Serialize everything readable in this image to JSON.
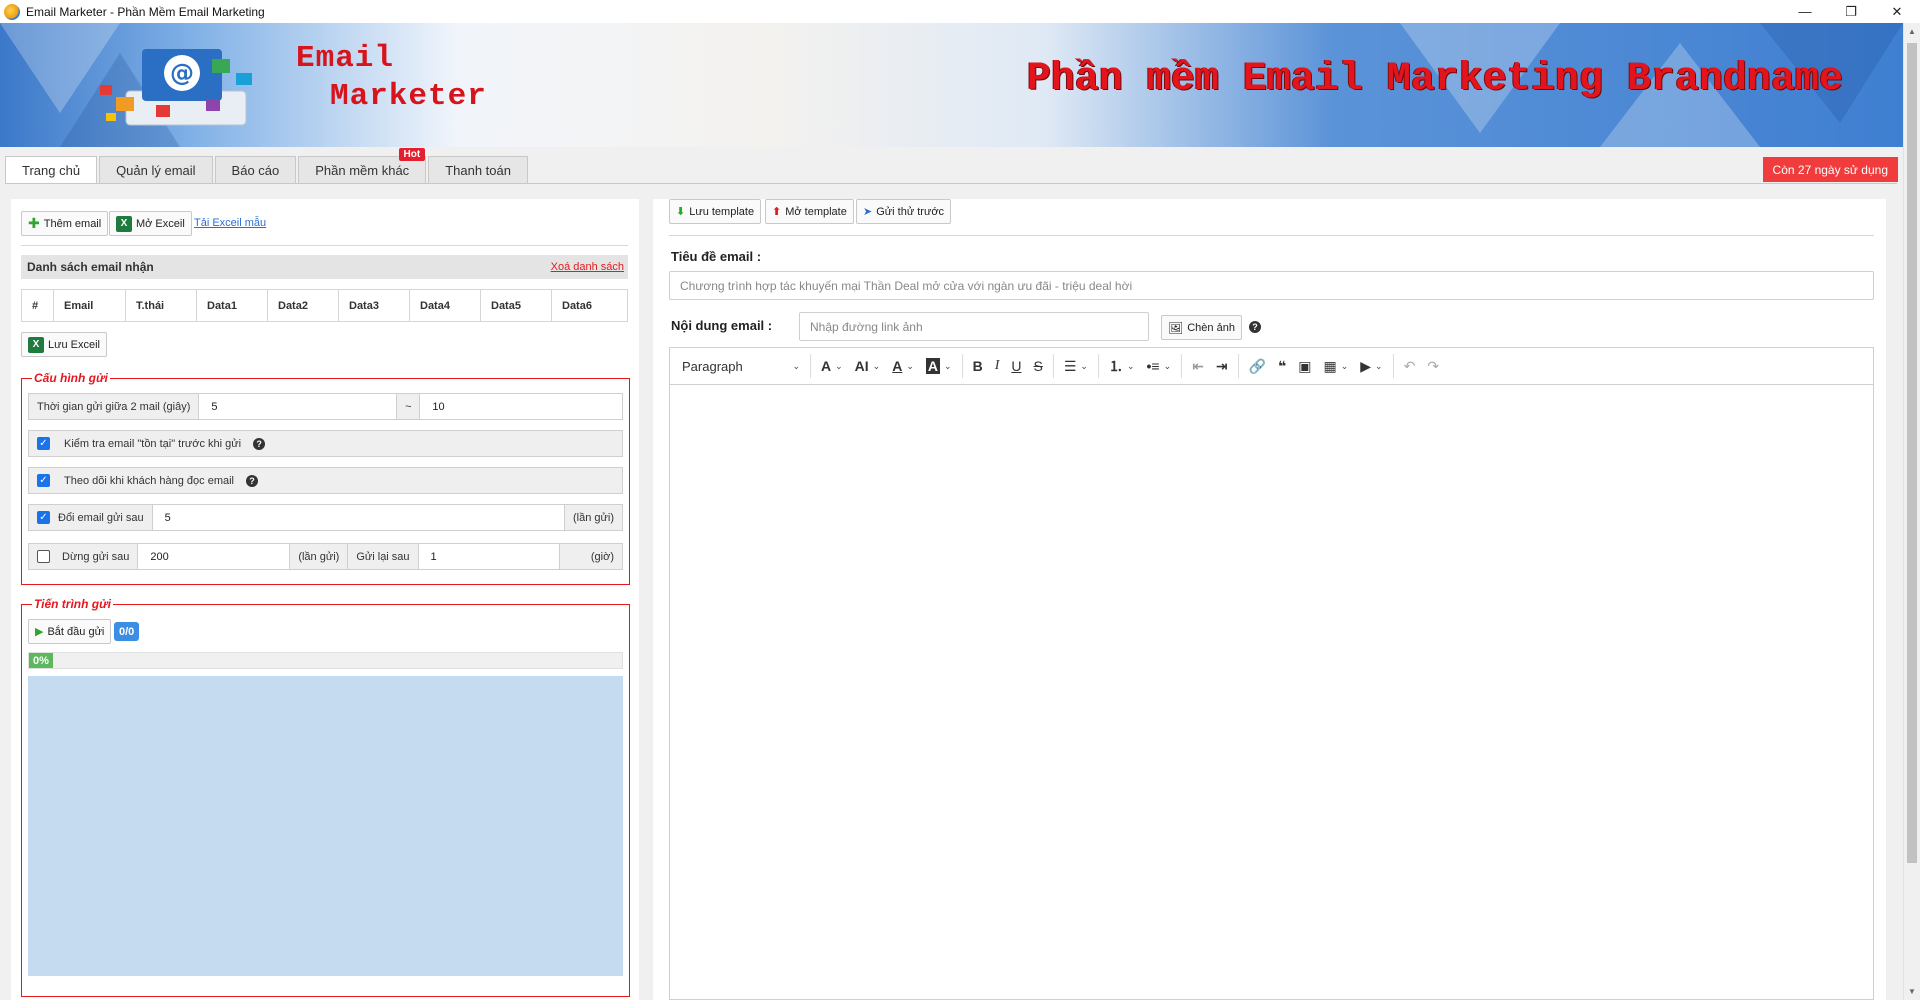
{
  "window": {
    "title": "Email Marketer - Phần Mềm Email Marketing",
    "minimize": "—",
    "restore": "❐",
    "close": "✕"
  },
  "banner": {
    "brand_line1": "Email",
    "brand_line2": "Marketer",
    "slogan": "Phần mềm Email Marketing Brandname"
  },
  "tabs": [
    {
      "label": "Trang chủ",
      "active": true
    },
    {
      "label": "Quản lý email"
    },
    {
      "label": "Báo cáo"
    },
    {
      "label": "Phần mềm khác",
      "badge": "Hot"
    },
    {
      "label": "Thanh toán"
    }
  ],
  "trial_notice": "Còn 27 ngày sử dụng",
  "left": {
    "add_email": "Thêm email",
    "open_excel": "Mở Exceil",
    "download_template": "Tải Exceil mẫu",
    "list_title": "Danh sách email nhận",
    "clear_list": "Xoá danh sách",
    "columns": [
      "#",
      "Email",
      "T.thái",
      "Data1",
      "Data2",
      "Data3",
      "Data4",
      "Data5",
      "Data6"
    ],
    "save_excel": "Lưu Exceil",
    "config": {
      "legend": "Cấu hình gửi",
      "delay_label": "Thời gian gửi giữa 2 mail (giây)",
      "delay_min": "5",
      "delay_sep": "~",
      "delay_max": "10",
      "check_exist_label": "Kiểm tra email \"tồn tại\" trước khi gửi",
      "check_exist": true,
      "track_open_label": "Theo dõi khi khách hàng đọc email",
      "track_open": true,
      "rotate_label": "Đổi email gửi sau",
      "rotate": true,
      "rotate_value": "5",
      "rotate_unit": "(lần gửi)",
      "pause_label": "Dừng gửi sau",
      "pause": false,
      "pause_value": "200",
      "pause_unit": "(lần gửi)",
      "resume_label": "Gửi lại sau",
      "resume_value": "1",
      "resume_unit": "(giờ)"
    },
    "progress": {
      "legend": "Tiến trình gửi",
      "start": "Bắt đầu gửi",
      "counter": "0/0",
      "percent_label": "0%",
      "percent": 0
    }
  },
  "right": {
    "save_template": "Lưu template",
    "open_template": "Mở template",
    "send_test": "Gửi thử trước",
    "subject_label": "Tiêu đề email :",
    "subject_value": "Chương trình hợp tác khuyến mại Thần Deal mở cửa với ngàn ưu đãi - triệu deal hời",
    "content_label": "Nội dung email :",
    "image_link_placeholder": "Nhập đường link ảnh",
    "insert_image": "Chèn ảnh",
    "paragraph": "Paragraph"
  }
}
